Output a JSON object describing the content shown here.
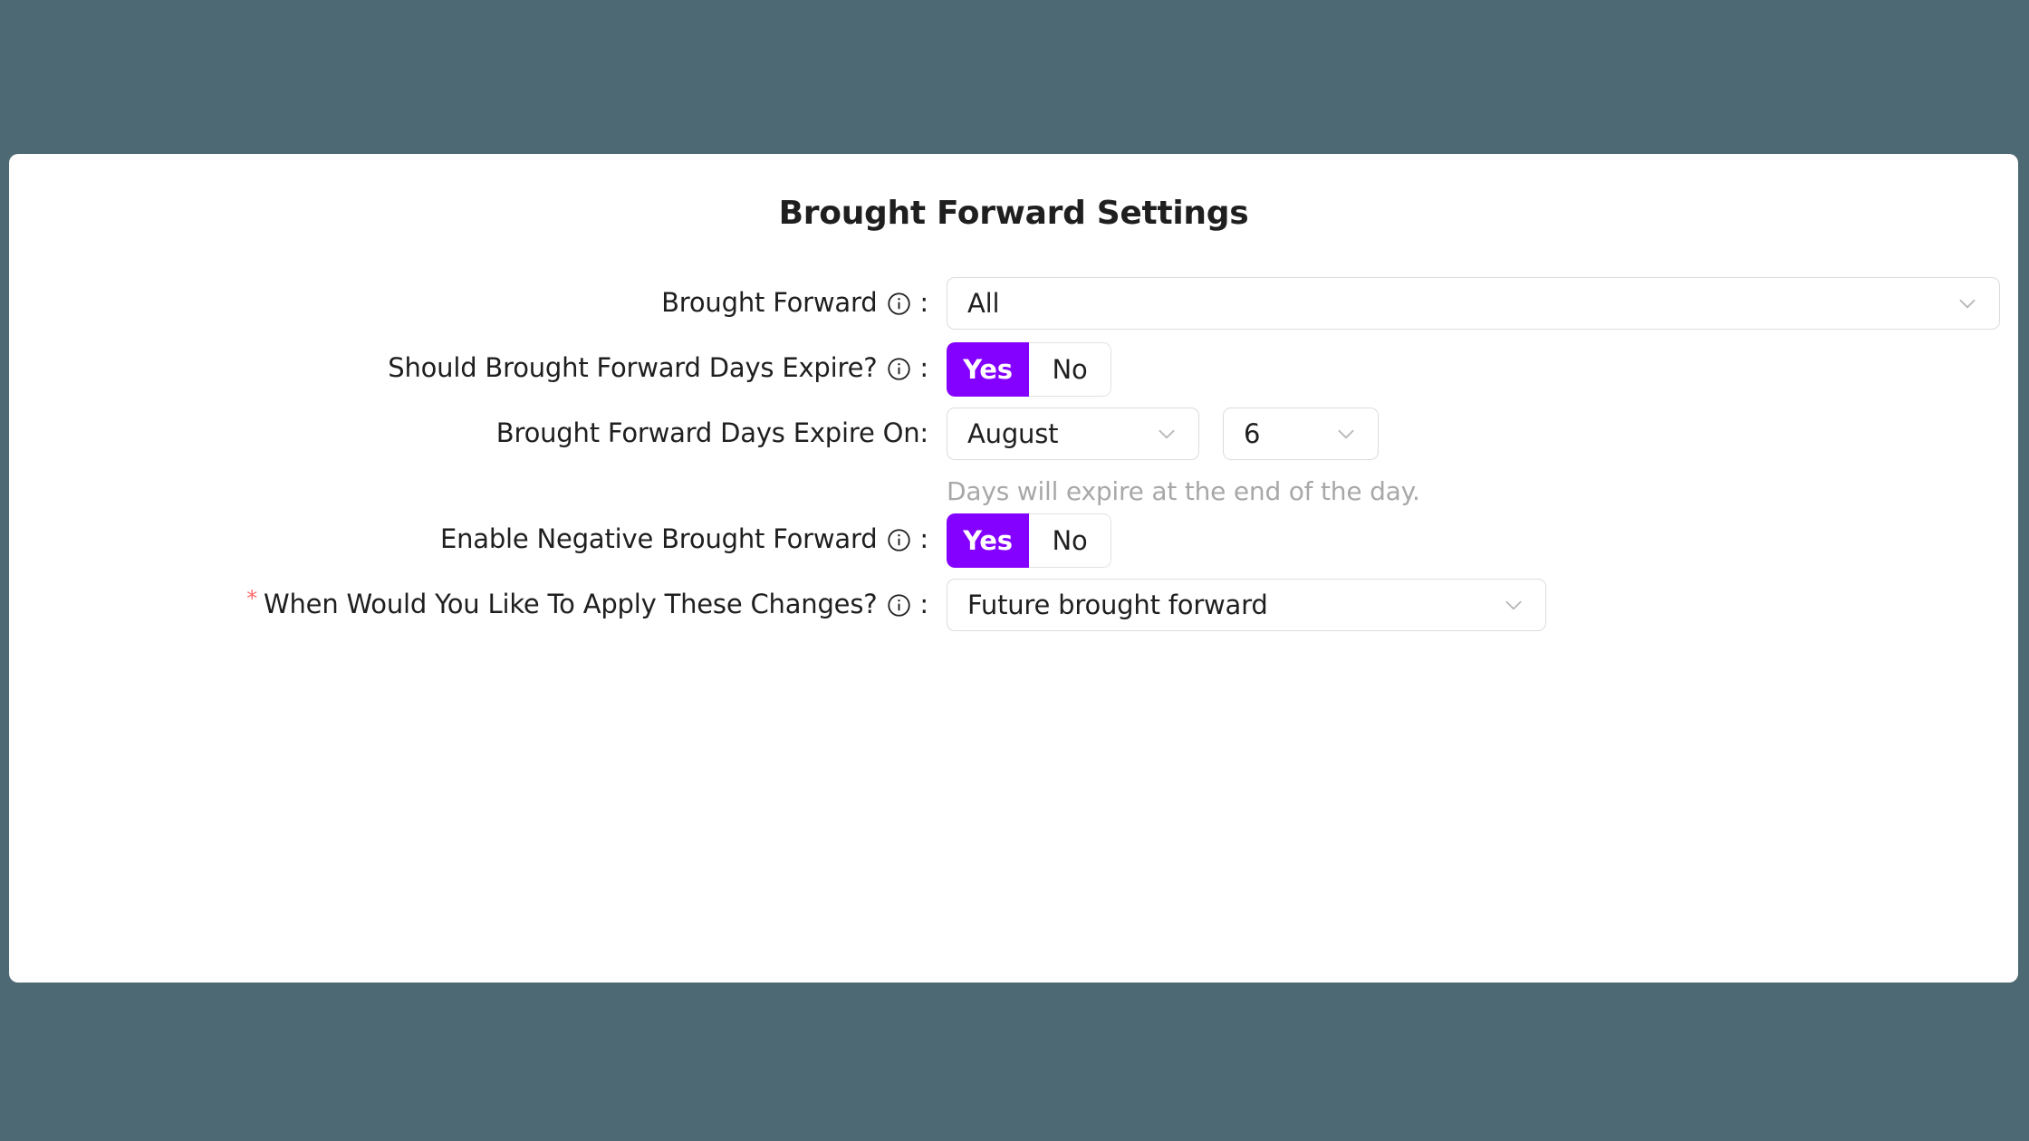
{
  "page": {
    "background_color": "#4d6973",
    "card_background": "#ffffff",
    "accent_color": "#8400ff",
    "required_marker_color": "#ff6b6b",
    "title": "Brought Forward Settings"
  },
  "form": {
    "rows": [
      {
        "label": "Brought Forward",
        "info_icon": "info-circle-icon",
        "colon": ":",
        "control": "select",
        "value": "All",
        "chevron": "chevron-down-icon"
      },
      {
        "label": "Should Brought Forward Days Expire?",
        "info_icon": "info-circle-icon",
        "colon": ":",
        "control": "toggle",
        "options": [
          "Yes",
          "No"
        ],
        "selected": "Yes"
      },
      {
        "label": "Brought Forward Days Expire On",
        "colon": ":",
        "control": "date-selects",
        "month_value": "August",
        "day_value": "6",
        "chevron": "chevron-down-icon",
        "helper_text": "Days will expire at the end of the day."
      },
      {
        "label": "Enable Negative Brought Forward",
        "info_icon": "info-circle-icon",
        "colon": ":",
        "control": "toggle",
        "options": [
          "Yes",
          "No"
        ],
        "selected": "Yes"
      },
      {
        "label": "When Would You Like To Apply These Changes?",
        "required_marker": "*",
        "info_icon": "info-circle-icon",
        "colon": ":",
        "control": "select",
        "value": "Future brought forward",
        "chevron": "chevron-down-icon"
      }
    ]
  }
}
